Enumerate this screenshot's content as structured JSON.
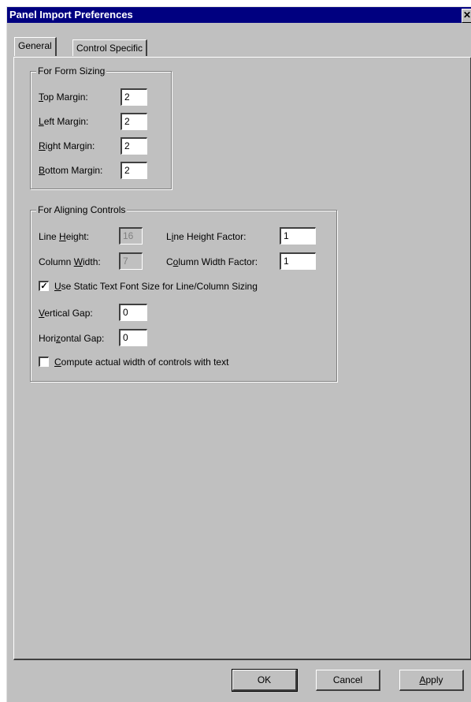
{
  "window": {
    "title": "Panel Import Preferences",
    "close_glyph": "✕"
  },
  "tabs": [
    {
      "label": "General",
      "active": true
    },
    {
      "label": "Control Specific",
      "active": false
    }
  ],
  "form_sizing": {
    "title": "For Form Sizing",
    "top_margin": {
      "mnemonic": "T",
      "rest": "op Margin:",
      "value": "2"
    },
    "left_margin": {
      "mnemonic": "L",
      "rest": "eft Margin:",
      "value": "2"
    },
    "right_margin": {
      "mnemonic": "R",
      "rest": "ight Margin:",
      "value": "2"
    },
    "bottom_margin": {
      "mnemonic": "B",
      "rest": "ottom Margin:",
      "value": "2"
    }
  },
  "aligning": {
    "title": "For Aligning Controls",
    "line_height": {
      "pre": "Line ",
      "mnemonic": "H",
      "rest": "eight:",
      "value": "16"
    },
    "column_width": {
      "pre": "Column ",
      "mnemonic": "W",
      "rest": "idth:",
      "value": "7"
    },
    "line_height_factor": {
      "pre": "L",
      "mnemonic": "i",
      "rest": "ne Height Factor:",
      "value": "1"
    },
    "column_width_factor": {
      "pre": "C",
      "mnemonic": "o",
      "rest": "lumn Width Factor:",
      "value": "1"
    },
    "use_static_text": {
      "mnemonic": "U",
      "rest": "se Static Text Font Size for Line/Column Sizing",
      "checked": true,
      "check_glyph": "✓"
    },
    "vertical_gap": {
      "mnemonic": "V",
      "rest": "ertical Gap:",
      "value": "0"
    },
    "horizontal_gap": {
      "pre": "Hori",
      "mnemonic": "z",
      "rest": "ontal Gap:",
      "value": "0"
    },
    "compute_actual": {
      "mnemonic": "C",
      "rest": "ompute actual width of controls with text",
      "checked": false
    }
  },
  "buttons": {
    "ok": "OK",
    "cancel": "Cancel",
    "apply_mnemonic": "A",
    "apply_rest": "pply"
  }
}
